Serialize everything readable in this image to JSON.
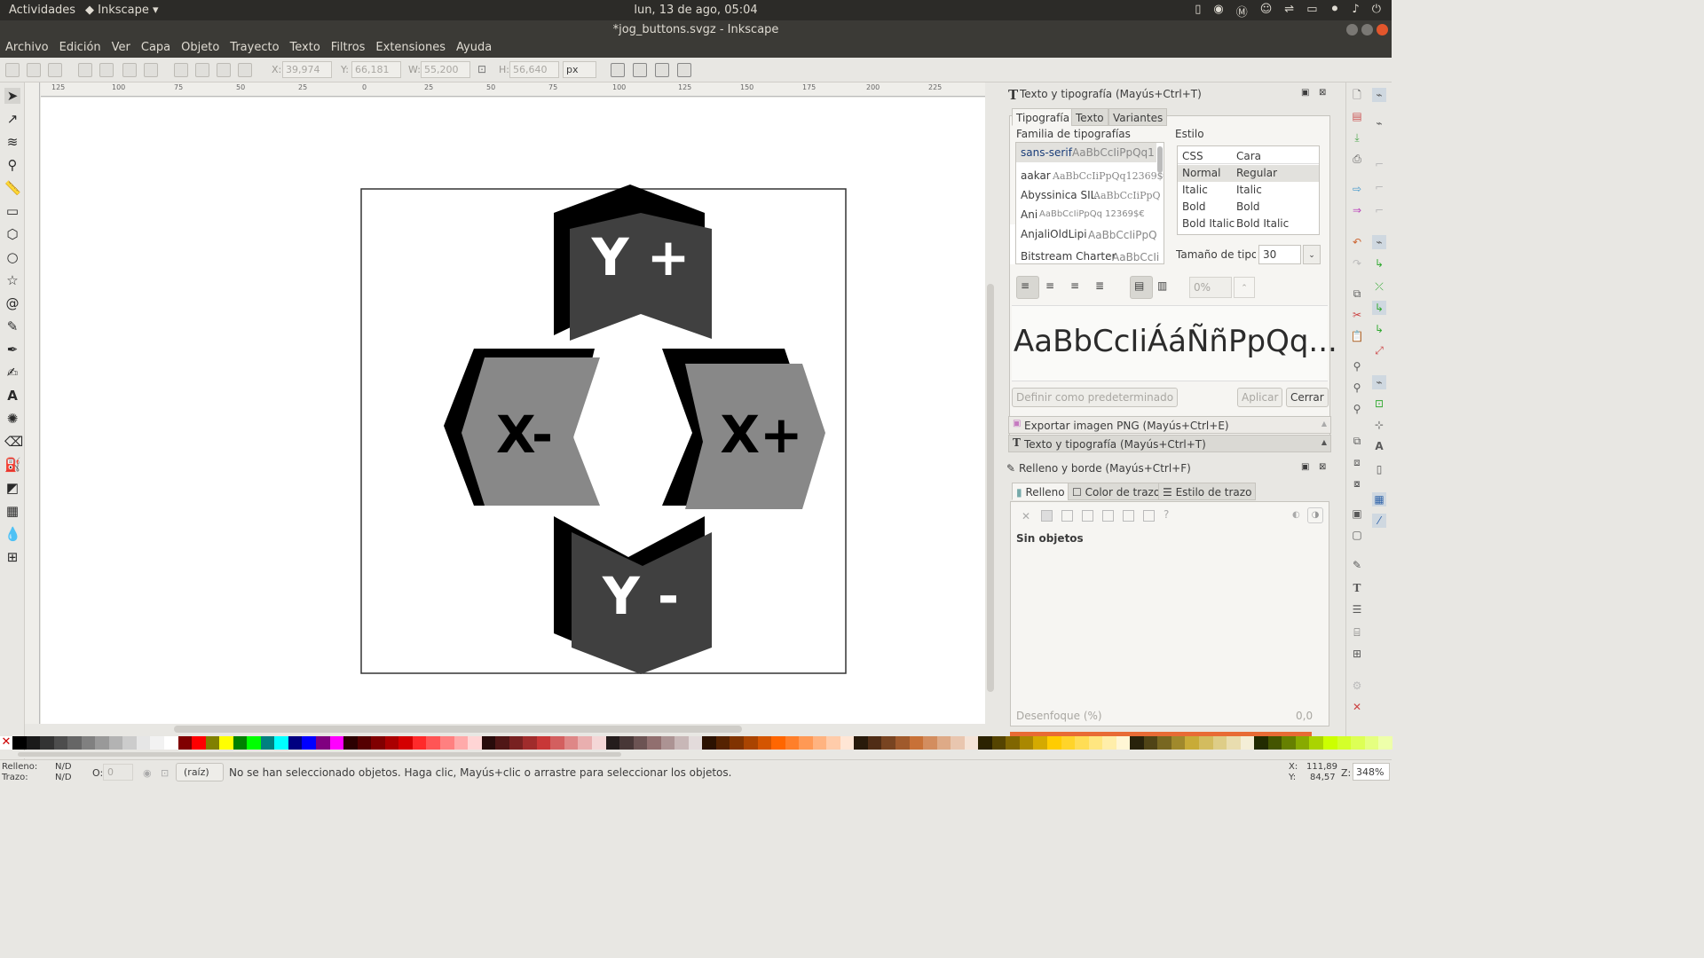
{
  "topbar": {
    "activities": "Actividades",
    "app": "Inkscape",
    "clock": "lun, 13 de ago, 05:04"
  },
  "window": {
    "title": "*jog_buttons.svgz - Inkscape"
  },
  "menu": [
    "Archivo",
    "Edición",
    "Ver",
    "Capa",
    "Objeto",
    "Trayecto",
    "Texto",
    "Filtros",
    "Extensiones",
    "Ayuda"
  ],
  "toolbar": {
    "x_label": "X:",
    "x_value": "39,974",
    "y_label": "Y:",
    "y_value": "66,181",
    "w_label": "W:",
    "w_value": "55,200",
    "h_label": "H:",
    "h_value": "56,640",
    "unit": "px"
  },
  "ruler": [
    "125",
    "100",
    "75",
    "50",
    "25",
    "0",
    "25",
    "50",
    "75",
    "100",
    "125",
    "150",
    "175",
    "200",
    "225"
  ],
  "canvas": {
    "buttons": [
      {
        "name": "y-plus",
        "label": "Y +",
        "fill": "#404040"
      },
      {
        "name": "x-minus",
        "label": "X-",
        "fill": "#888888"
      },
      {
        "name": "x-plus",
        "label": "X+",
        "fill": "#888888"
      },
      {
        "name": "y-minus",
        "label": "Y -",
        "fill": "#404040"
      }
    ]
  },
  "text_panel": {
    "title": "Texto y tipografía (Mayús+Ctrl+T)",
    "tabs": [
      "Tipografía",
      "Texto",
      "Variantes"
    ],
    "family_header": "Familia de tipografías",
    "style_header": "Estilo",
    "fonts": [
      {
        "name": "sans-serif",
        "sample": "AaBbCcIiPpQq1"
      },
      {
        "name": "aakar",
        "sample": "AaBbCcIiPpQq12369$€"
      },
      {
        "name": "Abyssinica SIL",
        "sample": "AaBbCcIiPpQ"
      },
      {
        "name": "Ani",
        "sample": "AaBbCcIiPpQq 12369$€"
      },
      {
        "name": "AnjaliOldLipi",
        "sample": "AaBbCcIiPpQ"
      },
      {
        "name": "Bitstream Charter",
        "sample": "AaBbCcIi"
      }
    ],
    "style_cols": [
      "CSS",
      "Cara"
    ],
    "styles": [
      [
        "Normal",
        "Regular"
      ],
      [
        "Italic",
        "Italic"
      ],
      [
        "Bold",
        "Bold"
      ],
      [
        "Bold Italic",
        "Bold Italic"
      ]
    ],
    "size_label": "Tamaño de tipog",
    "size_value": "30",
    "spacing_value": "0%",
    "preview": "AaBbCcIiÁáÑñPpQq...",
    "set_default": "Definir como predeterminado",
    "apply": "Aplicar",
    "close": "Cerrar"
  },
  "collapsed": [
    "Exportar imagen PNG (Mayús+Ctrl+E)",
    "Texto y tipografía (Mayús+Ctrl+T)"
  ],
  "fill_panel": {
    "title": "Relleno y borde (Mayús+Ctrl+F)",
    "tabs": [
      "Relleno",
      "Color de trazo",
      "Estilo de trazo"
    ],
    "no_objects": "Sin objetos",
    "blur_label": "Desenfoque (%)",
    "blur_value": "0,0"
  },
  "status": {
    "fill_label": "Relleno:",
    "fill_value": "N/D",
    "stroke_label": "Trazo:",
    "stroke_value": "N/D",
    "opacity_label": "O:",
    "opacity_value": "0",
    "layer": "(raíz)",
    "message": "No se han seleccionado objetos. Haga clic, Mayús+clic o arrastre para seleccionar los objetos.",
    "x_label": "X:",
    "x": "111,89",
    "y_label": "Y:",
    "y": "84,57",
    "zoom_label": "Z:",
    "zoom": "348%"
  },
  "palette": [
    "#000000",
    "#1a1a1a",
    "#333333",
    "#4d4d4d",
    "#666666",
    "#808080",
    "#999999",
    "#b3b3b3",
    "#cccccc",
    "#e6e6e6",
    "#f2f2f2",
    "#ffffff",
    "#800000",
    "#ff0000",
    "#808000",
    "#ffff00",
    "#008000",
    "#00ff00",
    "#008080",
    "#00ffff",
    "#000080",
    "#0000ff",
    "#800080",
    "#ff00ff",
    "#2b0000",
    "#550000",
    "#800000",
    "#aa0000",
    "#d40000",
    "#ff2a2a",
    "#ff5555",
    "#ff8080",
    "#ffaaaa",
    "#ffd5d5",
    "#280b0b",
    "#501616",
    "#782121",
    "#a02c2c",
    "#c83737",
    "#d35f5f",
    "#de8787",
    "#e9afaf",
    "#f4d7d7",
    "#241c1c",
    "#483737",
    "#6c5353",
    "#916f6f",
    "#ac9393",
    "#c8b7b7",
    "#e3dbdb",
    "#2b1100",
    "#552200",
    "#803300",
    "#aa4400",
    "#d45500",
    "#ff6600",
    "#ff7f2a",
    "#ff9955",
    "#ffb380",
    "#ffccaa",
    "#ffe6d5",
    "#281a0b",
    "#502d16",
    "#784421",
    "#a05a2c",
    "#c87137",
    "#d38d5f",
    "#deaa87",
    "#e9c6af",
    "#f4e3d7",
    "#2b2200",
    "#554400",
    "#806600",
    "#aa8800",
    "#d4aa00",
    "#ffcc00",
    "#ffd42a",
    "#ffdd55",
    "#ffe680",
    "#ffeeaa",
    "#fff6d5",
    "#28220b",
    "#504416",
    "#786721",
    "#a0892c",
    "#c8ab37",
    "#d3bc5f",
    "#decd87",
    "#e9ddaf",
    "#f4eed7",
    "#222b00",
    "#445500",
    "#668000",
    "#88aa00",
    "#aad400",
    "#ccff00",
    "#d4ff2a",
    "#ddff55",
    "#e5ff80",
    "#eeffaa"
  ]
}
